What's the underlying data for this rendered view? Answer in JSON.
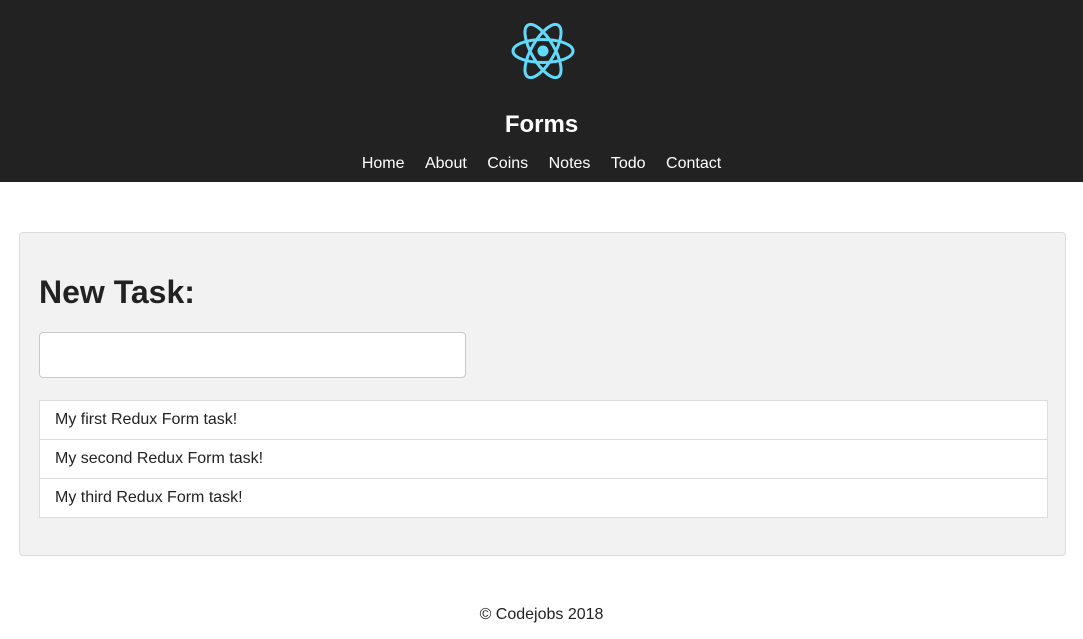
{
  "header": {
    "logo_icon": "react-atom-icon",
    "logo_color": "#61dafb",
    "background": "#222222",
    "title": "Forms",
    "nav": [
      {
        "label": "Home"
      },
      {
        "label": "About"
      },
      {
        "label": "Coins"
      },
      {
        "label": "Notes"
      },
      {
        "label": "Todo"
      },
      {
        "label": "Contact"
      }
    ]
  },
  "main": {
    "heading": "New Task:",
    "task_input": {
      "value": "",
      "placeholder": ""
    },
    "tasks": [
      {
        "text": "My first Redux Form task!"
      },
      {
        "text": "My second Redux Form task!"
      },
      {
        "text": "My third Redux Form task!"
      }
    ]
  },
  "footer": {
    "copyright": "© Codejobs 2018"
  }
}
